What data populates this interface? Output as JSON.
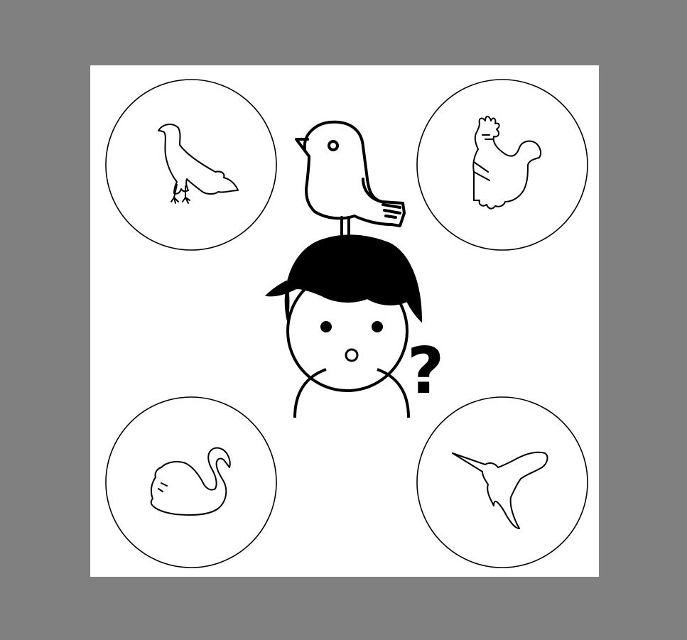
{
  "scene": {
    "background_color": "#808080",
    "panel_color": "#ffffff",
    "ink_color": "#000000",
    "question_mark": "?",
    "icons": {
      "top_left": "eagle-icon",
      "top_right": "rooster-icon",
      "bottom_left": "swan-icon",
      "bottom_right": "hummingbird-icon",
      "center_bird": "bird-icon",
      "person": "person-icon"
    }
  }
}
